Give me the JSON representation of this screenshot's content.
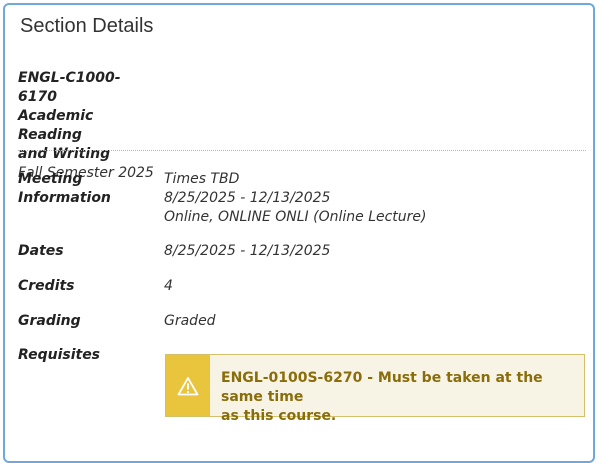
{
  "panel": {
    "title": "Section Details"
  },
  "course": {
    "code": "ENGL-C1000-6170",
    "name_line1": "Academic Reading",
    "name_line2": "and Writing",
    "term": "Fall Semester 2025"
  },
  "details": {
    "meeting": {
      "label_line1": "Meeting",
      "label_line2": "Information",
      "times": "Times TBD",
      "dates": "8/25/2025 - 12/13/2025",
      "location": "Online, ONLINE ONLI (Online Lecture)"
    },
    "dates": {
      "label": "Dates",
      "value": "8/25/2025 - 12/13/2025"
    },
    "credits": {
      "label": "Credits",
      "value": "4"
    },
    "grading": {
      "label": "Grading",
      "value": "Graded"
    },
    "requisites": {
      "label": "Requisites",
      "message_line1": "ENGL-0100S-6270 - Must be taken at the same time",
      "message_line2": "as this course.",
      "icon": "warning-icon"
    }
  },
  "colors": {
    "panel_border": "#6ea9dc",
    "alert_icon_bg": "#e9c43d",
    "alert_bg": "#f7f4e6",
    "alert_text": "#8a6d0b"
  }
}
